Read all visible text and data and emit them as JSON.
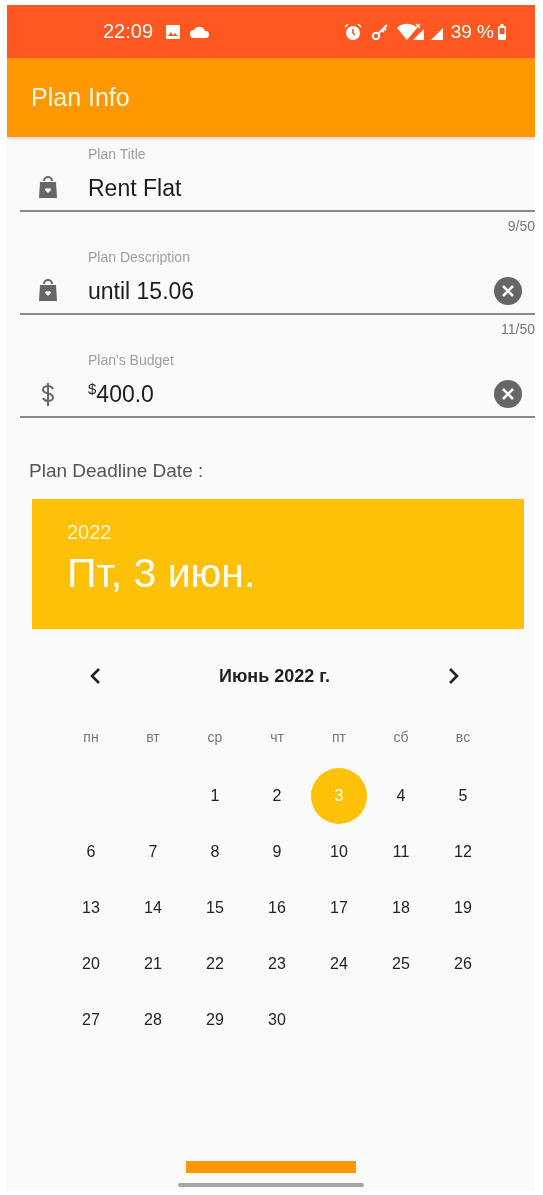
{
  "status_bar": {
    "time": "22:09",
    "battery": "39 %"
  },
  "app_bar": {
    "title": "Plan Info"
  },
  "fields": [
    {
      "kind": "bag",
      "label": "Plan Title",
      "value": "Rent Flat",
      "clearable": false,
      "counter": "9/50"
    },
    {
      "kind": "bag",
      "label": "Plan Description",
      "value": "until 15.06",
      "clearable": true,
      "counter": "11/50"
    },
    {
      "kind": "money",
      "label": "Plan's Budget",
      "value": "$^{$}$400.0",
      "clearable": true
    }
  ],
  "deadline_label": "Plan Deadline Date :",
  "date_header": {
    "year": "2022",
    "date": "Пт, 3 июн."
  },
  "calendar": {
    "month": "Июнь 2022 г.",
    "weekdays": [
      "пн",
      "вт",
      "ср",
      "чт",
      "пт",
      "сб",
      "вс"
    ],
    "weeks": [
      [
        {
          "day": "1",
          "selected": false
        },
        {
          "day": "2",
          "selected": false
        },
        {
          "day": "3",
          "selected": true
        },
        {
          "day": "4",
          "selected": false
        },
        {
          "day": "5",
          "selected": false
        }
      ],
      [
        {
          "day": "6",
          "selected": false
        },
        {
          "day": "7",
          "selected": false
        },
        {
          "day": "8",
          "selected": false
        },
        {
          "day": "9",
          "selected": false
        },
        {
          "day": "10",
          "selected": false
        },
        {
          "day": "11",
          "selected": false
        },
        {
          "day": "12",
          "selected": false
        }
      ],
      [
        {
          "day": "13",
          "selected": false
        },
        {
          "day": "14",
          "selected": false
        },
        {
          "day": "15",
          "selected": false
        },
        {
          "day": "16",
          "selected": false
        },
        {
          "day": "17",
          "selected": false
        },
        {
          "day": "18",
          "selected": false
        },
        {
          "day": "19",
          "selected": false
        }
      ],
      [
        {
          "day": "20",
          "selected": false
        },
        {
          "day": "21",
          "selected": false
        },
        {
          "day": "22",
          "selected": false
        },
        {
          "day": "23",
          "selected": false
        },
        {
          "day": "24",
          "selected": false
        },
        {
          "day": "25",
          "selected": false
        },
        {
          "day": "26",
          "selected": false
        }
      ],
      [
        {
          "day": "27",
          "selected": false
        },
        {
          "day": "28",
          "selected": false
        },
        {
          "day": "29",
          "selected": false
        },
        {
          "day": "30",
          "selected": false
        }
      ]
    ]
  }
}
